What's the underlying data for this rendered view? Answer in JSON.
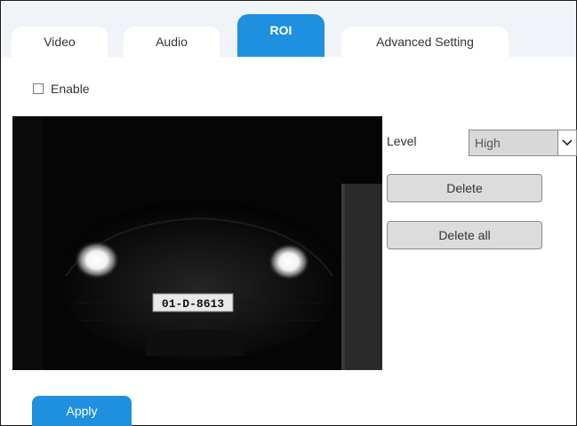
{
  "tabs": [
    {
      "label": "Video"
    },
    {
      "label": "Audio"
    },
    {
      "label": "ROI"
    },
    {
      "label": "Advanced Setting"
    }
  ],
  "active_tab": "ROI",
  "accent_color": "#1f8fe0",
  "enable": {
    "label": "Enable",
    "checked": false
  },
  "video": {
    "plate_text": "01-D-8613"
  },
  "level": {
    "label": "Level",
    "value": "High"
  },
  "buttons": {
    "delete": "Delete",
    "delete_all": "Delete all",
    "apply": "Apply"
  }
}
